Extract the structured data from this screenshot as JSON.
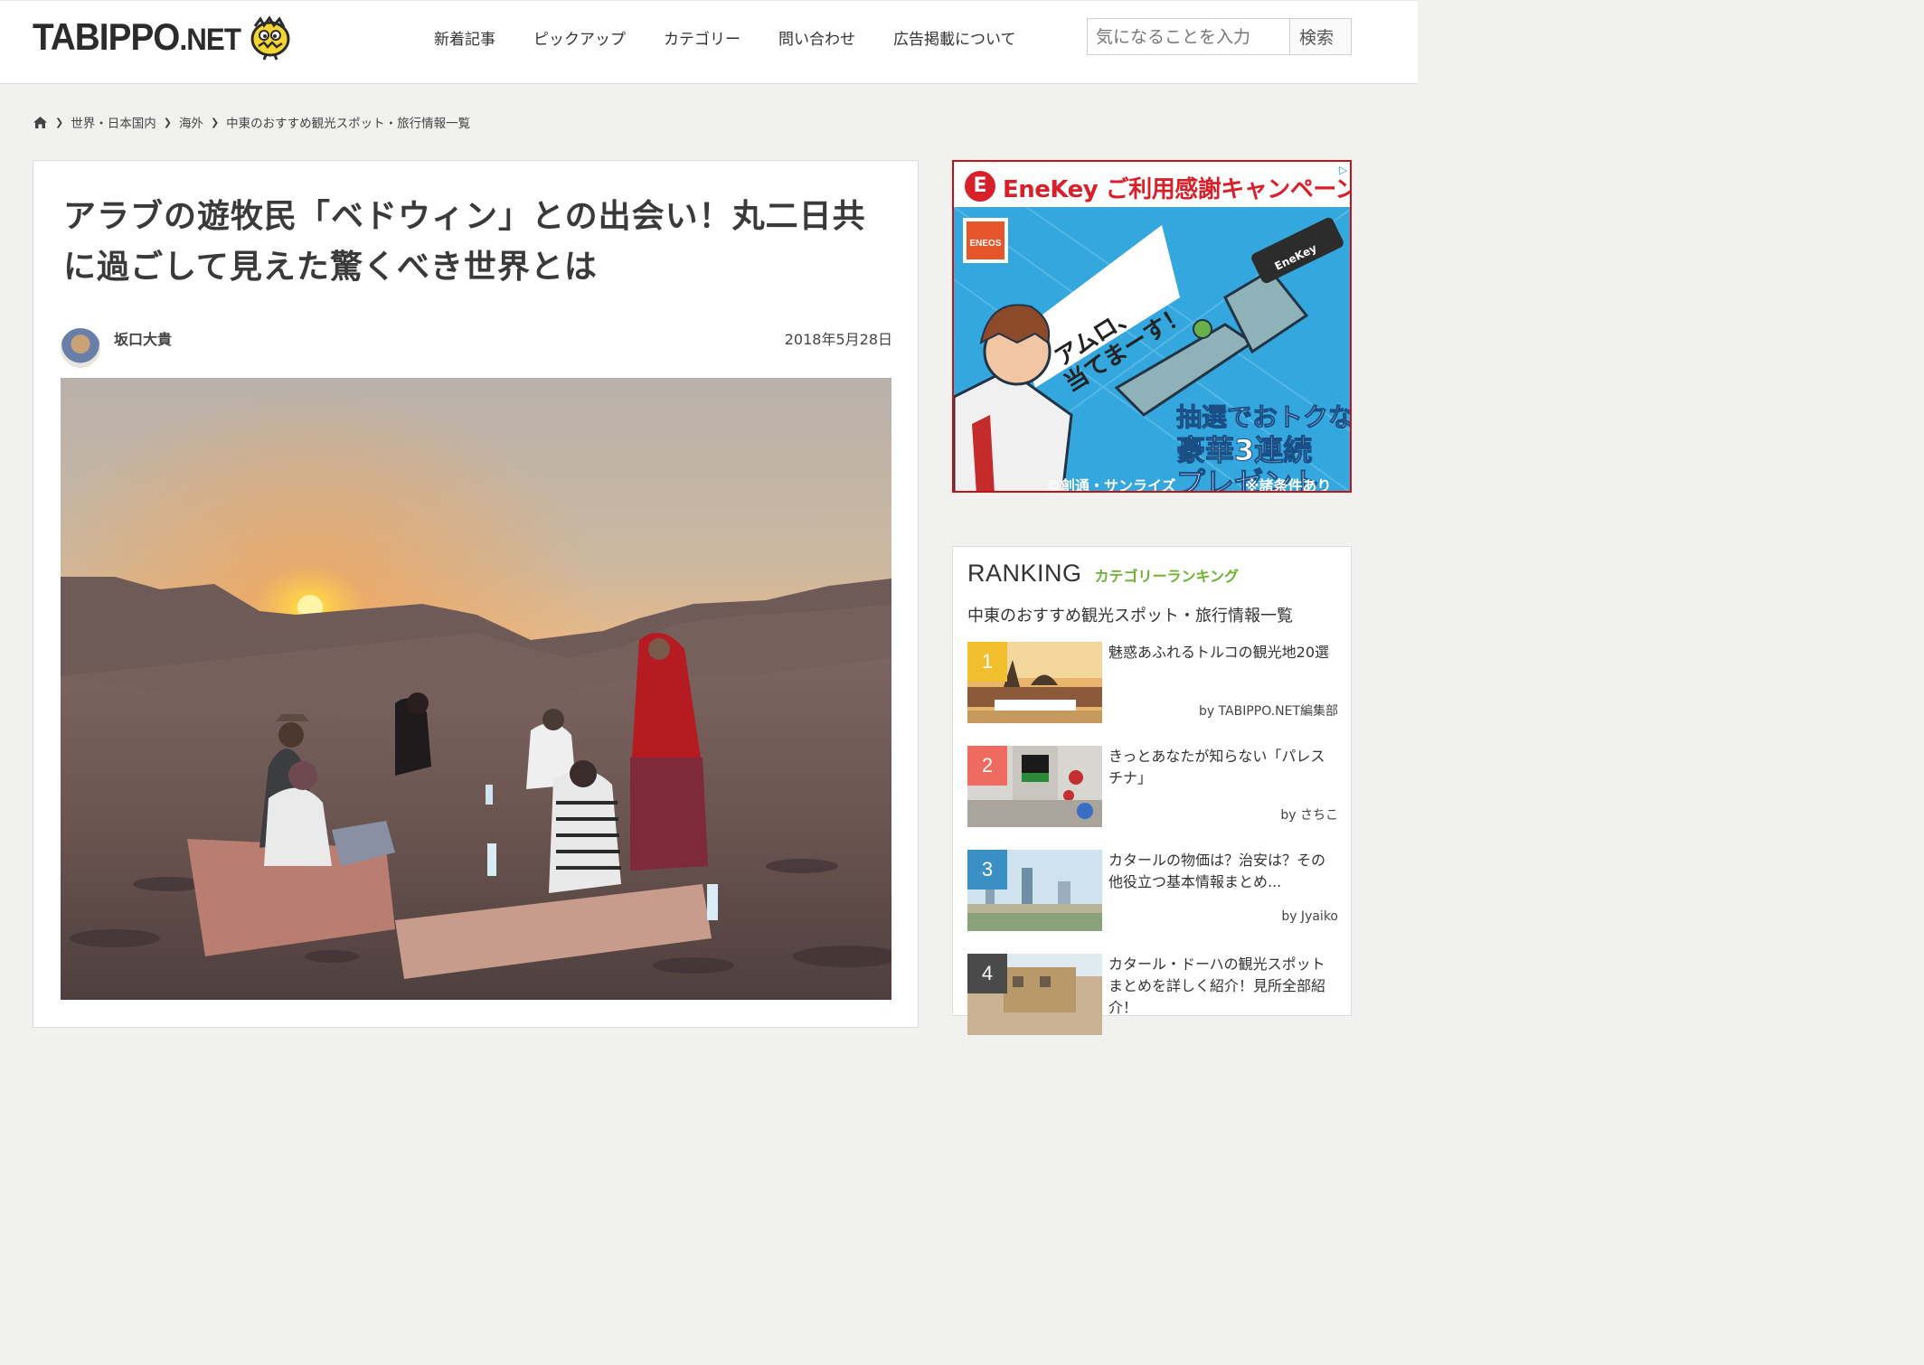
{
  "header": {
    "logo_main": "TABIPPO",
    "logo_suffix": ".NET",
    "nav": [
      "新着記事",
      "ピックアップ",
      "カテゴリー",
      "問い合わせ",
      "広告掲載について"
    ],
    "search_placeholder": "気になることを入力",
    "search_button": "検索"
  },
  "breadcrumb": [
    "世界・日本国内",
    "海外",
    "中東のおすすめ観光スポット・旅行情報一覧"
  ],
  "article": {
    "title": "アラブの遊牧民「ベドウィン」との出会い！丸二日共に過ごして見えた驚くべき世界とは",
    "author": "坂口大貴",
    "date": "2018年5月28日"
  },
  "ad": {
    "brand_mark": "E",
    "headline": "EneKey ご利用感謝キャンペーン",
    "eneos": "ENEOS",
    "bubble_line1": "アムロ、",
    "bubble_line2": "当てまーす！",
    "key_label": "EneKey",
    "promo_line1": "抽選でおトクな",
    "promo_line2": "豪華3連続",
    "promo_line3": "プレゼント",
    "copyright": "©創通・サンライズ",
    "note": "※諸条件あり"
  },
  "ranking": {
    "title_en": "RANKING",
    "title_ja": "カテゴリーランキング",
    "subtitle": "中東のおすすめ観光スポット・旅行情報一覧",
    "items": [
      {
        "rank": "1",
        "title": "魅惑あふれるトルコの観光地20選",
        "by": "by TABIPPO.NET編集部",
        "badge_color": "#f2bf2c"
      },
      {
        "rank": "2",
        "title": "きっとあなたが知らない「パレスチナ」",
        "by": "by さちこ",
        "badge_color": "#ef6b61"
      },
      {
        "rank": "3",
        "title": "カタールの物価は？治安は？その他役立つ基本情報まとめ...",
        "by": "by Jyaiko",
        "badge_color": "#3a8fc4"
      },
      {
        "rank": "4",
        "title": "カタール・ドーハの観光スポットまとめを詳しく紹介！見所全部紹介！",
        "by": "",
        "badge_color": "#4a4a4a"
      }
    ]
  }
}
